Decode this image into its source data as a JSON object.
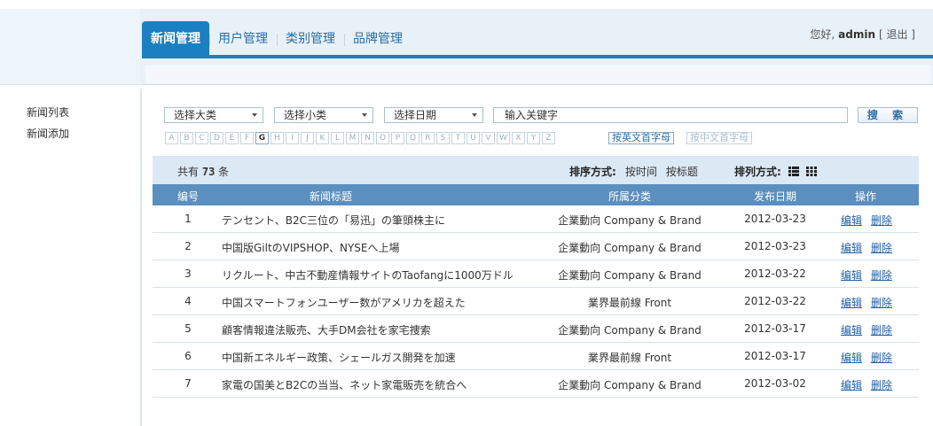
{
  "nav": {
    "tabs": [
      {
        "label": "新闻管理",
        "active": true
      },
      {
        "label": "用户管理",
        "active": false
      },
      {
        "label": "类别管理",
        "active": false
      },
      {
        "label": "品牌管理",
        "active": false
      }
    ],
    "greeting_prefix": "您好,",
    "username": "admin",
    "logout_label": "[ 退出 ]"
  },
  "sidebar": {
    "items": [
      {
        "label": "新闻列表"
      },
      {
        "label": "新闻添加"
      }
    ]
  },
  "search": {
    "category_main": "选择大类",
    "category_sub": "选择小类",
    "date": "选择日期",
    "keyword_value": "输入关键字",
    "button_label": "搜 索"
  },
  "letter_filter": {
    "letters": [
      "A",
      "B",
      "C",
      "D",
      "E",
      "F",
      "G",
      "H",
      "I",
      "J",
      "K",
      "L",
      "M",
      "N",
      "O",
      "P",
      "Q",
      "R",
      "S",
      "T",
      "U",
      "V",
      "W",
      "X",
      "Y",
      "Z"
    ],
    "active_letter": "G",
    "mode_en_label": "按英文首字母",
    "mode_cn_label": "按中文首字母"
  },
  "summary": {
    "total_prefix": "共有",
    "total_count": "73",
    "total_suffix": "条",
    "sort_label": "排序方式:",
    "sort_options": [
      "按时间",
      "按标题"
    ],
    "layout_label": "排列方式:",
    "layout_icons": [
      "list-view-icon",
      "grid-view-icon"
    ]
  },
  "table": {
    "columns": [
      "编号",
      "新闻标题",
      "所属分类",
      "发布日期",
      "操作"
    ],
    "rows": [
      {
        "no": "1",
        "title": "テンセント、B2C三位の「易迅」の筆頭株主に",
        "category": "企業動向 Company & Brand",
        "date": "2012-03-23"
      },
      {
        "no": "2",
        "title": "中国版GiltのVIPSHOP、NYSEへ上場",
        "category": "企業動向 Company & Brand",
        "date": "2012-03-23"
      },
      {
        "no": "3",
        "title": "リクルート、中古不動産情報サイトのTaofangに1000万ドル",
        "category": "企業動向 Company & Brand",
        "date": "2012-03-22"
      },
      {
        "no": "4",
        "title": "中国スマートフォンユーザー数がアメリカを超えた",
        "category": "業界最前線 Front",
        "date": "2012-03-22"
      },
      {
        "no": "5",
        "title": "顧客情報違法販売、大手DM会社を家宅捜索",
        "category": "企業動向 Company & Brand",
        "date": "2012-03-17"
      },
      {
        "no": "6",
        "title": "中国新エネルギー政策、シェールガス開発を加速",
        "category": "業界最前線 Front",
        "date": "2012-03-17"
      },
      {
        "no": "7",
        "title": "家電の国美とB2Cの当当、ネット家電販売を統合へ",
        "category": "企業動向 Company & Brand",
        "date": "2012-03-02"
      }
    ],
    "edit_label": "编辑",
    "delete_label": "删除"
  },
  "colors": {
    "accent": "#1b7fc0",
    "table_header": "#5a8fc0",
    "summary_bg": "#dbe9f5",
    "link": "#1f5fa8"
  }
}
